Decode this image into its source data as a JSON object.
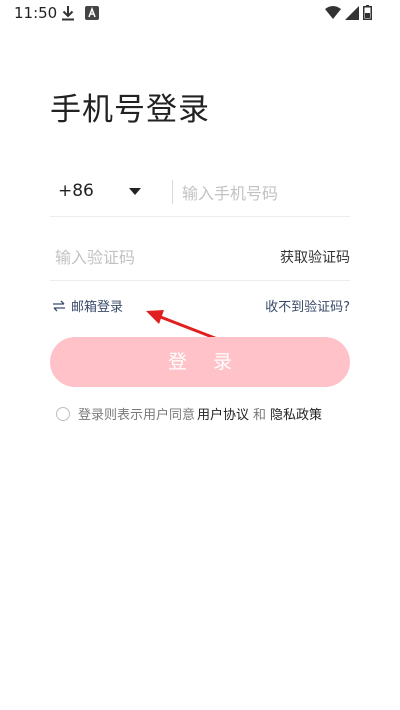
{
  "status_bar": {
    "time": "11:50",
    "icons": [
      "download-icon",
      "a-icon",
      "wifi-icon",
      "signal-icon",
      "battery-icon"
    ]
  },
  "page": {
    "title": "手机号登录"
  },
  "phone": {
    "country_code": "+86",
    "placeholder": "输入手机号码",
    "value": ""
  },
  "verification": {
    "placeholder": "输入验证码",
    "value": "",
    "get_code_label": "获取验证码"
  },
  "links": {
    "email_login": "邮箱登录",
    "no_code": "收不到验证码?"
  },
  "login": {
    "label": "登 录"
  },
  "agreement": {
    "prefix": "登录则表示用户同意",
    "user_agreement": "用户协议",
    "conjunction": "和",
    "privacy_policy": "隐私政策",
    "checked": false
  },
  "colors": {
    "login_button": "#ffc2c8",
    "link": "#3a4a6a",
    "annotation_arrow": "#e02020"
  }
}
